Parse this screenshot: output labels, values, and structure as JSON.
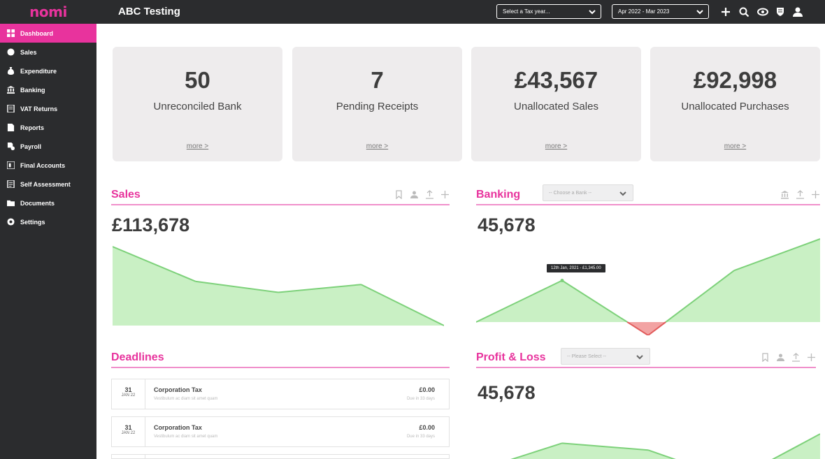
{
  "app": {
    "logo": "nomi",
    "title": "ABC Testing"
  },
  "topbar": {
    "tax_year_select": "Select a Tax year...",
    "period_select": "Apr 2022 - Mar 2023",
    "icons": [
      "plus-icon",
      "search-icon",
      "handshake-icon",
      "crest-icon",
      "user-icon"
    ]
  },
  "sidebar": {
    "items": [
      {
        "label": "Dashboard",
        "icon": "dashboard-icon",
        "active": true
      },
      {
        "label": "Sales",
        "icon": "sales-icon"
      },
      {
        "label": "Expenditure",
        "icon": "money-bag-icon"
      },
      {
        "label": "Banking",
        "icon": "bank-icon"
      },
      {
        "label": "VAT Returns",
        "icon": "vat-icon"
      },
      {
        "label": "Reports",
        "icon": "report-icon"
      },
      {
        "label": "Payroll",
        "icon": "payroll-icon"
      },
      {
        "label": "Final Accounts",
        "icon": "final-accounts-icon"
      },
      {
        "label": "Self Assessment",
        "icon": "self-assessment-icon"
      },
      {
        "label": "Documents",
        "icon": "folder-icon"
      },
      {
        "label": "Settings",
        "icon": "settings-icon"
      }
    ]
  },
  "stats": [
    {
      "value": "50",
      "label": "Unreconciled Bank",
      "more": "more >"
    },
    {
      "value": "7",
      "label": "Pending Receipts",
      "more": "more >"
    },
    {
      "value": "£43,567",
      "label": "Unallocated Sales",
      "more": "more >"
    },
    {
      "value": "£92,998",
      "label": "Unallocated Purchases",
      "more": "more >"
    }
  ],
  "sales": {
    "title": "Sales",
    "total": "£113,678"
  },
  "banking": {
    "title": "Banking",
    "select_placeholder": "-- Choose a Bank --",
    "total": "45,678",
    "tooltip": "12th Jan, 2021 - £1,345.00"
  },
  "deadlines": {
    "title": "Deadlines",
    "items": [
      {
        "day": "31",
        "month": "JAN 22",
        "title": "Corporation Tax",
        "desc": "Vestibulum ac diam sit amet quam",
        "amount": "£0.00",
        "due": "Due in 33 days"
      },
      {
        "day": "31",
        "month": "JAN 22",
        "title": "Corporation Tax",
        "desc": "Vestibulum ac diam sit amet quam",
        "amount": "£0.00",
        "due": "Due in 33 days"
      }
    ]
  },
  "profit_loss": {
    "title": "Profit & Loss",
    "select_placeholder": "-- Please Select --",
    "total": "45,678"
  },
  "colors": {
    "accent": "#e8339d",
    "sidebar": "#2b2c2e",
    "chart_fill": "#c9f0c4",
    "chart_line": "#7dd17a",
    "negative": "#e25b5b"
  },
  "chart_data": [
    {
      "type": "area",
      "title": "Sales",
      "x": [
        0,
        1,
        2,
        3,
        4,
        5
      ],
      "values": [
        100,
        56,
        42,
        52,
        0
      ],
      "series_points": 5
    },
    {
      "type": "area",
      "title": "Banking",
      "values": [
        0,
        50,
        -16,
        62,
        100
      ]
    },
    {
      "type": "area",
      "title": "Profit & Loss",
      "values": [
        0,
        60,
        45,
        -20,
        80
      ]
    }
  ]
}
